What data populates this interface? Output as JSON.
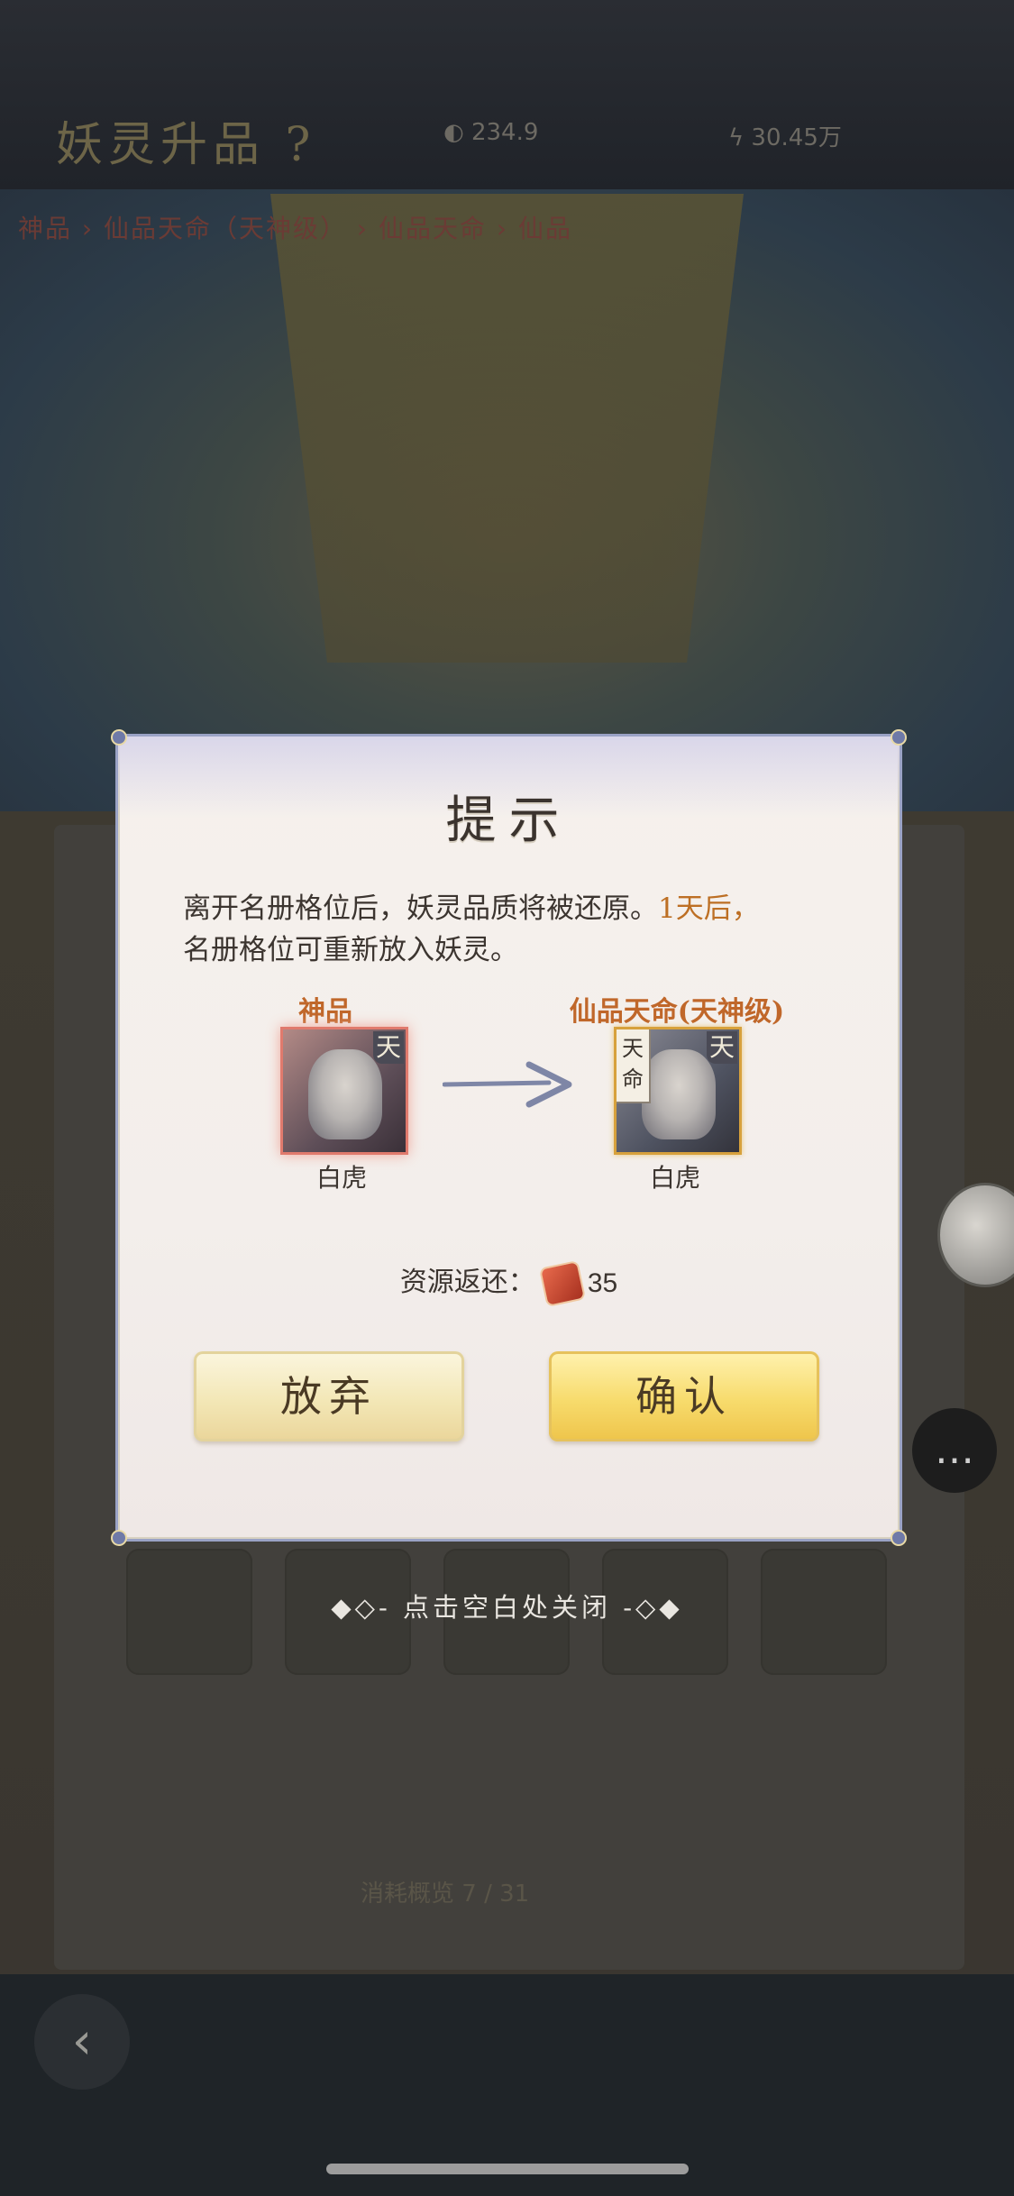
{
  "background": {
    "title": "妖灵升品 ?",
    "resource_1": "234.9",
    "resource_2": "30.45万",
    "breadcrumb": "神品 › 仙品天命（天神级） › 仙品天命 › 仙品",
    "bottom_text": "消耗概览   7 / 31"
  },
  "dialog": {
    "title": "提示",
    "message_part1": "离开名册格位后，妖灵品质将被还原。",
    "message_highlight": "1天后，",
    "message_part2": "名册格位可重新放入妖灵。",
    "from_grade": "神品",
    "to_grade": "仙品天命(天神级)",
    "from_name": "白虎",
    "to_name": "白虎",
    "badge_tian": "天",
    "badge_tianming": "天命",
    "return_label": "资源返还：",
    "return_value": "35",
    "abandon_label": "放弃",
    "confirm_label": "确认"
  },
  "close_hint": "◆◇- 点击空白处关闭 -◇◆",
  "colors": {
    "highlight": "#bd6f24",
    "grade": "#c0672a",
    "dialog_border": "#9aa2c5"
  }
}
